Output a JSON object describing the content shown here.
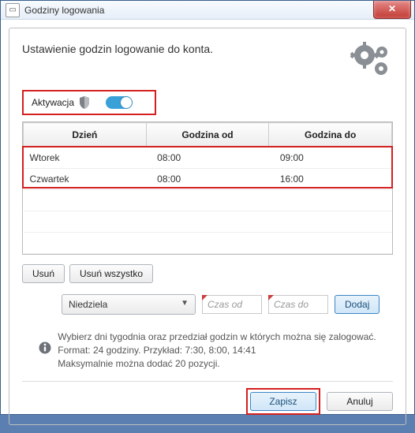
{
  "window": {
    "title": "Godziny logowania"
  },
  "header": {
    "subtitle": "Ustawienie godzin logowanie do konta."
  },
  "activation": {
    "label": "Aktywacja",
    "on": true
  },
  "table": {
    "columns": [
      "Dzień",
      "Godzina od",
      "Godzina do"
    ],
    "rows": [
      {
        "day": "Wtorek",
        "from": "08:00",
        "to": "09:00"
      },
      {
        "day": "Czwartek",
        "from": "08:00",
        "to": "16:00"
      }
    ]
  },
  "manage": {
    "delete": "Usuń",
    "delete_all": "Usuń wszystko"
  },
  "add": {
    "day_value": "Niedziela",
    "from_placeholder": "Czas od",
    "to_placeholder": "Czas do",
    "add_label": "Dodaj"
  },
  "info": {
    "line1": "Wybierz dni tygodnia oraz przedział godzin w których można się zalogować.",
    "line2": "Format: 24 godziny. Przykład: 7:30, 8:00, 14:41",
    "line3": "Maksymalnie można dodać 20 pozycji."
  },
  "footer": {
    "save": "Zapisz",
    "cancel": "Anuluj"
  },
  "colors": {
    "highlight": "#d42020",
    "accent": "#3c86c4"
  }
}
